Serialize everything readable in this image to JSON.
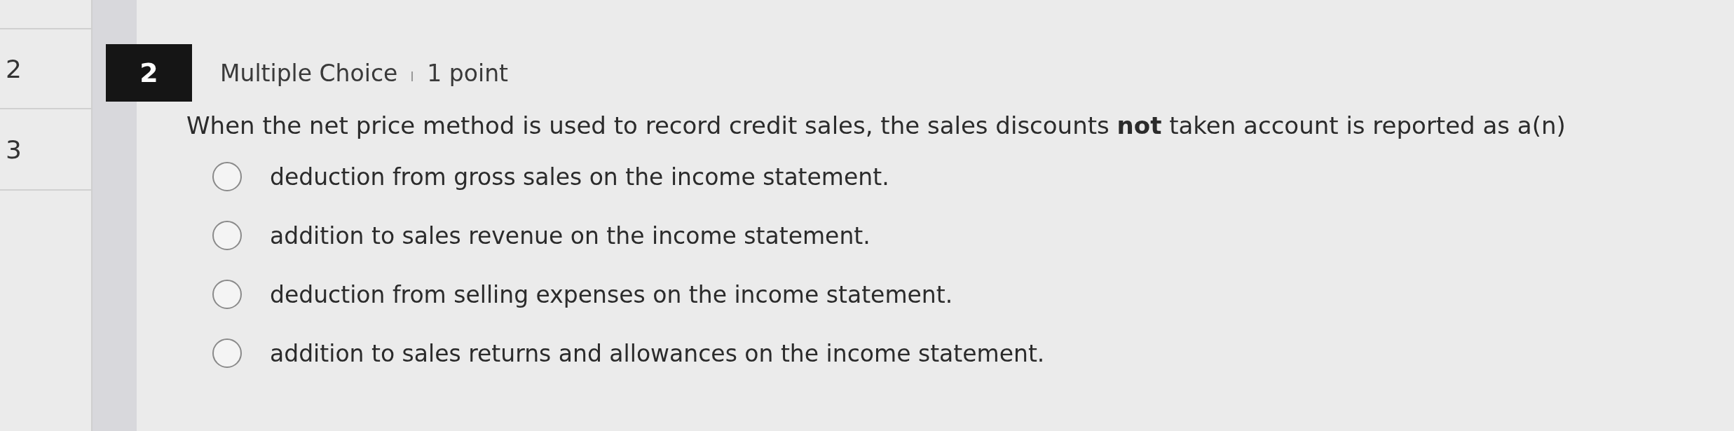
{
  "nav": [
    {
      "label": "2"
    },
    {
      "label": "3"
    }
  ],
  "question": {
    "number": "2",
    "type": "Multiple Choice",
    "points": "1 point",
    "prompt": "When the net price method is used to record credit sales, the sales discounts **not** taken account is reported as a(n)",
    "options": [
      {
        "text": "deduction from gross sales on the income statement.",
        "selected": false
      },
      {
        "text": "addition to sales revenue on the income statement.",
        "selected": false
      },
      {
        "text": "deduction from selling expenses on the income statement.",
        "selected": false
      },
      {
        "text": "addition to sales returns and allowances on the income statement.",
        "selected": false
      }
    ]
  }
}
